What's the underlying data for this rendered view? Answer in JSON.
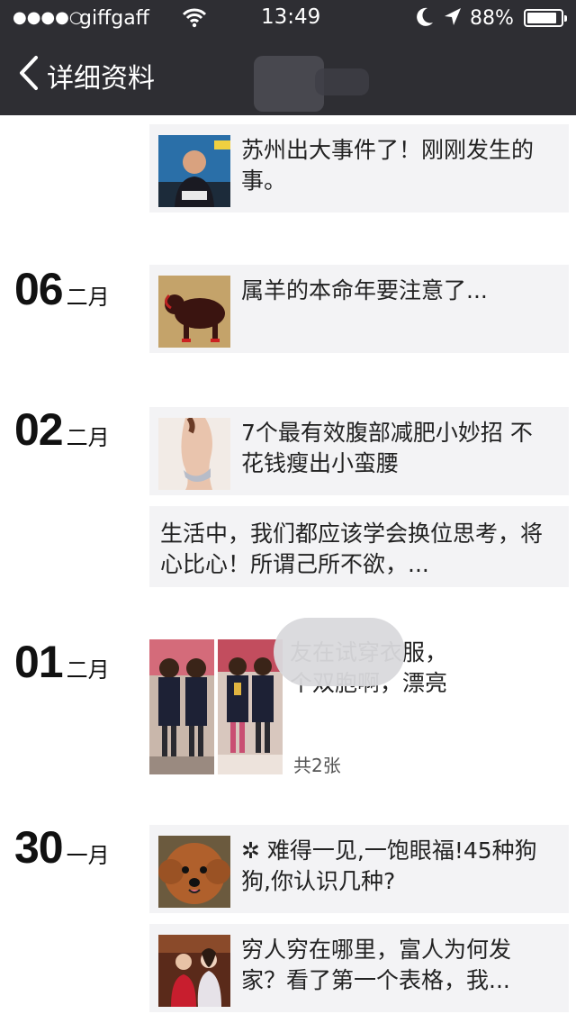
{
  "status_bar": {
    "signal": "●●●●○",
    "carrier": "giffgaff",
    "time": "13:49",
    "battery": "88%"
  },
  "nav": {
    "title": "详细资料"
  },
  "posts": [
    {
      "text": "苏州出大事件了！刚刚发生的事。"
    },
    {
      "day": "06",
      "month": "二月",
      "text": "属羊的本命年要注意了..."
    },
    {
      "day": "02",
      "month": "二月",
      "text": "7个最有效腹部减肥小妙招 不花钱瘦出小蛮腰"
    },
    {
      "text": "生活中，我们都应该学会换位思考，将心比心！所谓己所不欲，..."
    },
    {
      "day": "01",
      "month": "二月",
      "line1": "友在试穿衣服，",
      "line2": "个双胞啊，漂亮",
      "count": "共2张"
    },
    {
      "day": "30",
      "month": "一月",
      "text": "✲ 难得一见,一饱眼福!45种狗狗,你认识几种?"
    },
    {
      "text": "穷人穷在哪里，富人为何发家？看了第一个表格，我..."
    }
  ]
}
